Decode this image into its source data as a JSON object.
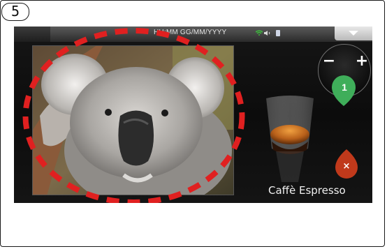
{
  "step_badge": "5",
  "statusbar": {
    "datetime": "HH:MM GG/MM/YYYY",
    "wifi_icon": "wifi-icon",
    "volume_icon": "speaker-icon",
    "battery_icon": "battery-icon",
    "menu_icon": "chevron-down-icon"
  },
  "screensaver": {
    "image": "koala-photo",
    "highlight_color": "#e02020"
  },
  "quantity": {
    "minus_label": "−",
    "plus_label": "+",
    "value": "1",
    "drop_color": "#3fae5a"
  },
  "cancel": {
    "label": "×",
    "drop_color": "#c0391b"
  },
  "drink": {
    "name": "Caffè Espresso"
  }
}
